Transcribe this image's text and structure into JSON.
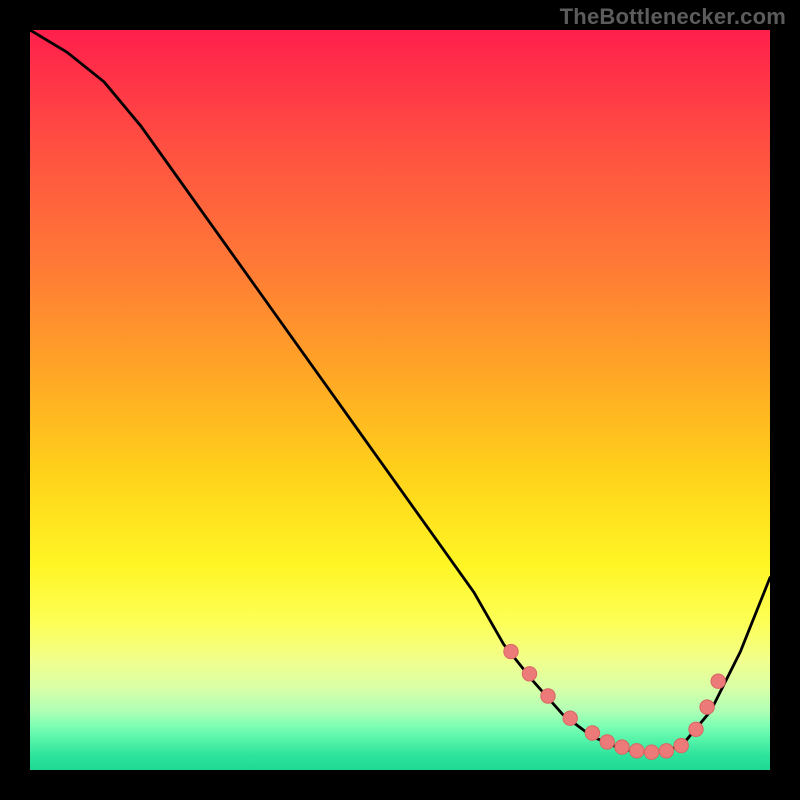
{
  "attribution": "TheBottlenecker.com",
  "colors": {
    "curve_stroke": "#000000",
    "marker_fill": "#ec7a78",
    "marker_stroke": "#d86662"
  },
  "chart_data": {
    "type": "line",
    "title": "",
    "xlabel": "",
    "ylabel": "",
    "xlim": [
      0,
      100
    ],
    "ylim": [
      0,
      100
    ],
    "grid": false,
    "series": [
      {
        "name": "bottleneck-curve",
        "x": [
          0,
          5,
          10,
          15,
          20,
          25,
          30,
          35,
          40,
          45,
          50,
          55,
          60,
          64,
          68,
          72,
          76,
          80,
          84,
          88,
          92,
          96,
          100
        ],
        "y": [
          100,
          97,
          93,
          87,
          80,
          73,
          66,
          59,
          52,
          45,
          38,
          31,
          24,
          17,
          12,
          7.5,
          4.5,
          2.8,
          2.3,
          3.2,
          8,
          16,
          26
        ],
        "markers_x": [
          65,
          67.5,
          70,
          73,
          76,
          78,
          80,
          82,
          84,
          86,
          88,
          90,
          91.5,
          93
        ],
        "markers_y": [
          16,
          13,
          10,
          7,
          5,
          3.8,
          3.1,
          2.6,
          2.4,
          2.6,
          3.3,
          5.5,
          8.5,
          12
        ]
      }
    ]
  }
}
